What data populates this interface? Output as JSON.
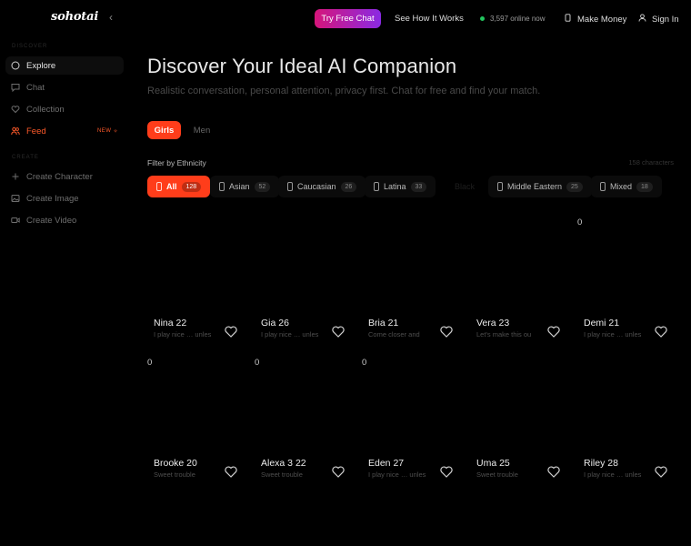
{
  "sidebar": {
    "logo": "sohotai",
    "collapse_glyph": "‹",
    "section_discover": "DISCOVER",
    "section_create": "CREATE",
    "items": [
      {
        "label": "Explore",
        "icon": "compass-icon"
      },
      {
        "label": "Chat",
        "icon": "chat-icon"
      },
      {
        "label": "Collection",
        "icon": "heart-icon"
      },
      {
        "label": "Feed",
        "icon": "users-icon",
        "badge": "NEW"
      },
      {
        "label": "Create Character",
        "icon": "plus-icon"
      },
      {
        "label": "Create Image",
        "icon": "image-icon"
      },
      {
        "label": "Create Video",
        "icon": "video-icon"
      }
    ]
  },
  "topbar": {
    "try_label": "Try Free Chat",
    "how_label": "See How It Works",
    "online_text": "3,597 online now",
    "money_label": "Make Money",
    "signin_label": "Sign In"
  },
  "hero": {
    "title": "Discover Your Ideal AI Companion",
    "subtitle": "Realistic conversation, personal attention, privacy first. Chat for free and find your match."
  },
  "tabs": {
    "girls": "Girls",
    "men": "Men"
  },
  "filter": {
    "label": "Filter by Ethnicity",
    "count_text": "158 characters",
    "chips": [
      {
        "label": "All",
        "count": "128"
      },
      {
        "label": "Asian",
        "count": "52"
      },
      {
        "label": "Caucasian",
        "count": "26"
      },
      {
        "label": "Latina",
        "count": "33"
      },
      {
        "label": "Black",
        "count": ""
      },
      {
        "label": "Middle Eastern",
        "count": "25"
      },
      {
        "label": "Mixed",
        "count": "18"
      }
    ]
  },
  "grid": {
    "zero": "0",
    "cards": [
      {
        "name": "Nina 22",
        "desc": "I play nice … unles"
      },
      {
        "name": "Gia 26",
        "desc": "I play nice … unles"
      },
      {
        "name": "Bria 21",
        "desc": "Come closer and"
      },
      {
        "name": "Vera 23",
        "desc": "Let's make this ou"
      },
      {
        "name": "Demi 21",
        "desc": "I play nice … unles"
      },
      {
        "name": "Brooke 20",
        "desc": "Sweet trouble"
      },
      {
        "name": "Alexa 3 22",
        "desc": "Sweet trouble"
      },
      {
        "name": "Eden 27",
        "desc": "I play nice … unles"
      },
      {
        "name": "Uma 25",
        "desc": "Sweet trouble"
      },
      {
        "name": "Riley 28",
        "desc": "I play nice … unles"
      }
    ]
  },
  "colors": {
    "accent": "#ff3d1a",
    "gradient_start": "#d6157a",
    "gradient_end": "#8a2ae3",
    "online": "#22c55e"
  }
}
